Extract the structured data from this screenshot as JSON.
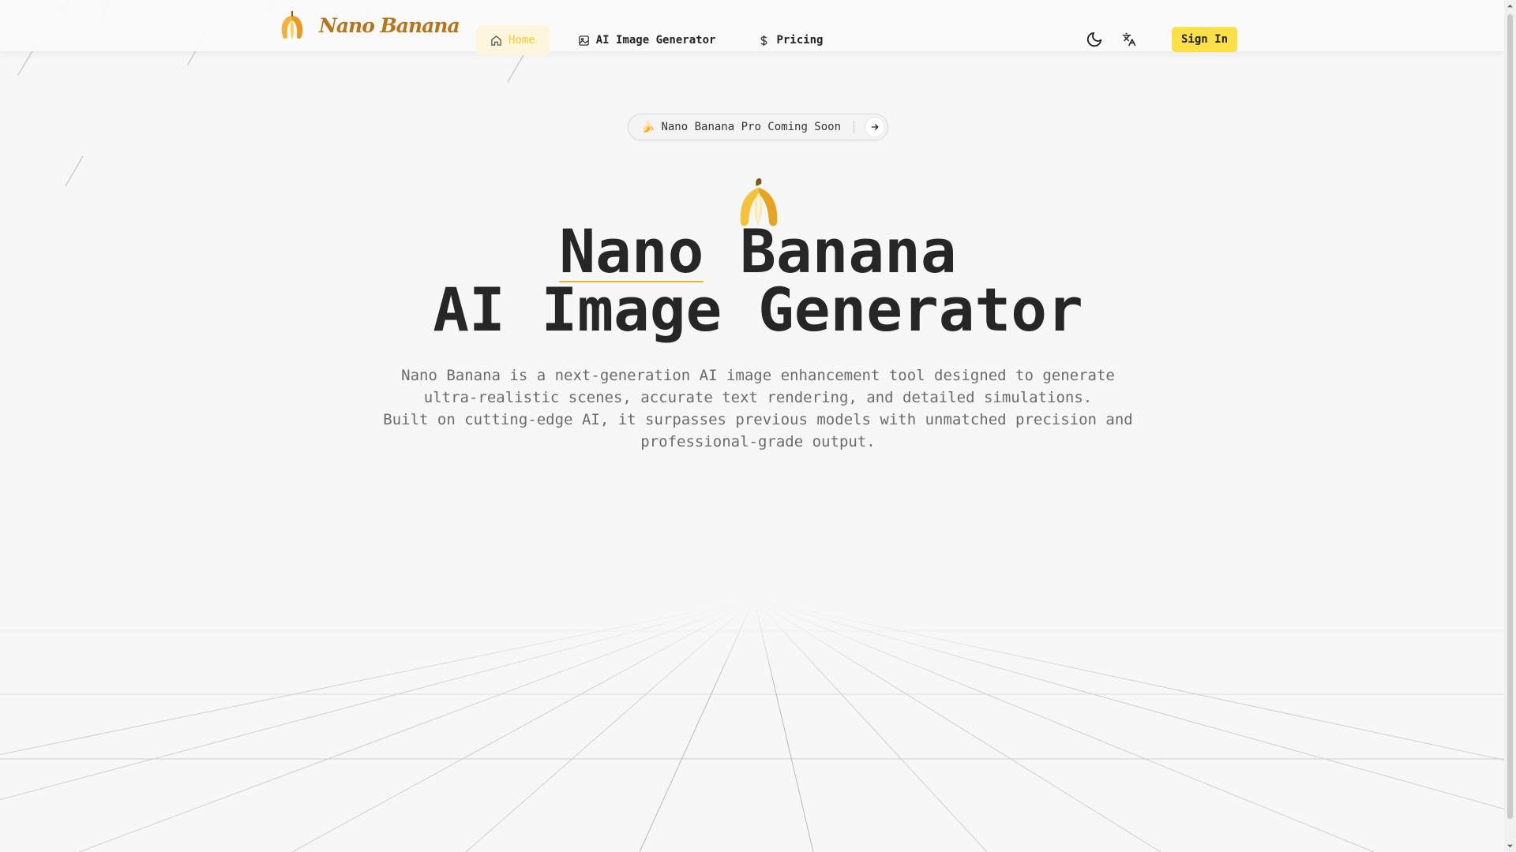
{
  "brand": {
    "name": "Nano Banana"
  },
  "nav": {
    "home": "Home",
    "generator": "AI Image Generator",
    "pricing": "Pricing"
  },
  "header": {
    "sign_in": "Sign In"
  },
  "announcement": {
    "icon": "🍌",
    "text": "Nano Banana Pro Coming Soon"
  },
  "hero": {
    "emoji": "🍌",
    "title_highlight": "Nano",
    "title_rest": " Banana",
    "title_line2": "AI Image Generator",
    "desc_line1": "Nano Banana is a next-generation AI image enhancement tool designed to generate",
    "desc_line2": "ultra-realistic scenes, accurate text rendering, and detailed simulations.",
    "desc_line3": "Built on cutting-edge AI, it surpasses previous models with unmatched precision and",
    "desc_line4": "professional-grade output."
  },
  "colors": {
    "accent": "#fde047",
    "brand": "#b8741a",
    "active_nav": "#f2cc2a",
    "underline": "#e8b23a"
  },
  "icons": [
    "banana-logo-icon",
    "home-icon",
    "image-icon",
    "dollar-icon",
    "moon-icon",
    "translate-icon",
    "arrow-right-icon"
  ]
}
